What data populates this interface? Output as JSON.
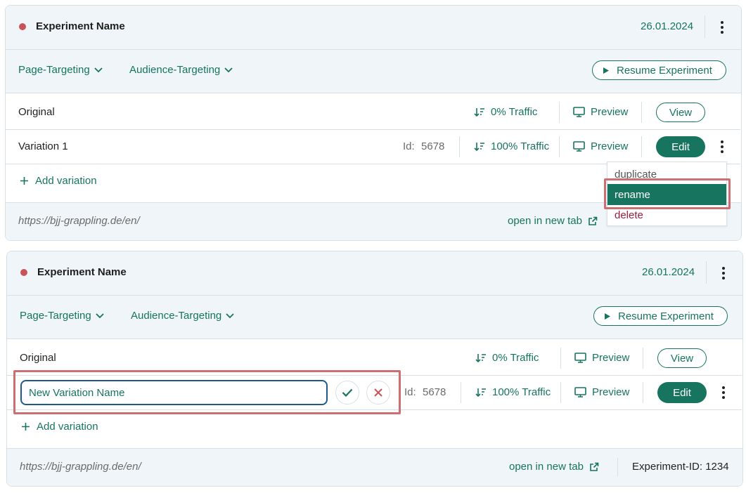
{
  "experiments": [
    {
      "title": "Experiment Name",
      "date": "26.01.2024",
      "page_targeting": "Page-Targeting",
      "audience_targeting": "Audience-Targeting",
      "resume_label": "Resume Experiment",
      "original": {
        "label": "Original",
        "traffic": "0% Traffic",
        "preview": "Preview",
        "action": "View"
      },
      "variation": {
        "label": "Variation 1",
        "id_label": "Id:",
        "id_value": "5678",
        "traffic": "100% Traffic",
        "preview": "Preview",
        "action": "Edit"
      },
      "add_variation": "Add variation",
      "url": "https://bjj-grappling.de/en/",
      "open_new_tab": "open in new tab"
    },
    {
      "title": "Experiment Name",
      "date": "26.01.2024",
      "page_targeting": "Page-Targeting",
      "audience_targeting": "Audience-Targeting",
      "resume_label": "Resume Experiment",
      "original": {
        "label": "Original",
        "traffic": "0% Traffic",
        "preview": "Preview",
        "action": "View"
      },
      "variation": {
        "name_input_value": "New Variation Name",
        "id_label": "Id:",
        "id_value": "5678",
        "traffic": "100% Traffic",
        "preview": "Preview",
        "action": "Edit"
      },
      "add_variation": "Add variation",
      "url": "https://bjj-grappling.de/en/",
      "open_new_tab": "open in new tab",
      "experiment_id": "Experiment-ID: 1234"
    }
  ],
  "context_menu": {
    "items": [
      "duplicate",
      "rename",
      "delete"
    ]
  },
  "colors": {
    "accent": "#17745f",
    "status_dot": "#c95457",
    "delete": "#9b1c3e",
    "highlight": "#cc6f72"
  },
  "icons": {
    "status": "status-dot-icon",
    "menu": "kebab-menu-icon",
    "dropdown": "chevron-down-icon",
    "play": "play-icon",
    "traffic": "sort-traffic-icon",
    "preview": "monitor-icon",
    "add": "plus-icon",
    "external": "external-link-icon",
    "confirm": "check-icon",
    "cancel": "close-icon"
  }
}
